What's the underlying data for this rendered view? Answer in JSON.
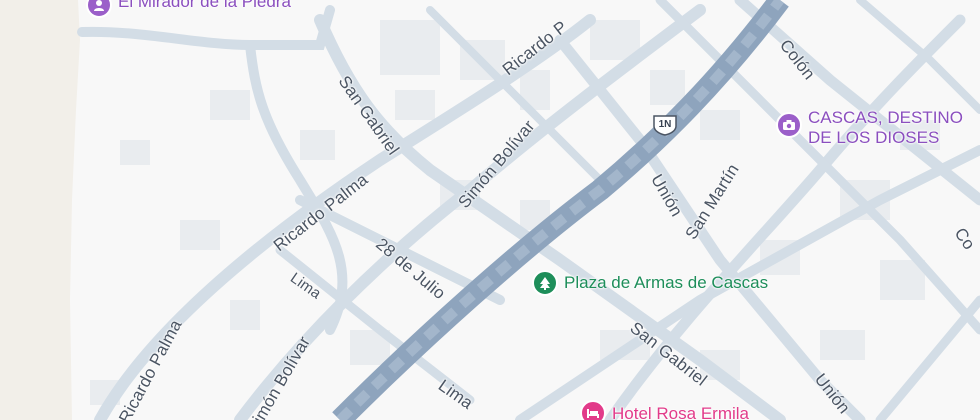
{
  "map": {
    "colors": {
      "background": "#f8f8f8",
      "hillside": "#f2efe9",
      "street": "#d3dde6",
      "highway": "#8ea4bd",
      "building": "#e9ecef",
      "poi_purple": "#9b5fc9",
      "poi_green": "#1e8e5a",
      "poi_pink": "#e23b8a"
    },
    "streets": [
      {
        "id": "ricardo-palma-upper",
        "label": "Ricardo P"
      },
      {
        "id": "san-gabriel-north",
        "label": "San Gabriel"
      },
      {
        "id": "colon",
        "label": "Colón"
      },
      {
        "id": "simon-bolivar-center",
        "label": "Simón Bolívar"
      },
      {
        "id": "ricardo-palma-mid",
        "label": "Ricardo Palma"
      },
      {
        "id": "union-center",
        "label": "Unión"
      },
      {
        "id": "san-martin",
        "label": "San Martín"
      },
      {
        "id": "veinte-ocho-de-julio",
        "label": "28 de Julio"
      },
      {
        "id": "lima-upper",
        "label": "Lima"
      },
      {
        "id": "ricardo-palma-lower",
        "label": "Ricardo Palma"
      },
      {
        "id": "san-gabriel-south",
        "label": "San Gabriel"
      },
      {
        "id": "simon-bolivar-lower",
        "label": "Simón Bolívar"
      },
      {
        "id": "lima-lower",
        "label": "Lima"
      },
      {
        "id": "union-south",
        "label": "Unión"
      },
      {
        "id": "co-edge",
        "label": "Co"
      }
    ],
    "highway_shield": {
      "label": "1N"
    },
    "pois": [
      {
        "id": "mirador",
        "lines": [
          "El Mirador de la Piedra"
        ],
        "icon": "person-pin-icon",
        "color": "#9b5fc9"
      },
      {
        "id": "cascas-destino",
        "lines": [
          "CASCAS, DESTINO",
          "DE LOS DIOSES"
        ],
        "icon": "camera-icon",
        "color": "#9b5fc9"
      },
      {
        "id": "plaza",
        "lines": [
          "Plaza de Armas de Cascas"
        ],
        "icon": "tree-icon",
        "color": "#1e8e5a"
      },
      {
        "id": "hotel",
        "lines": [
          "Hotel Rosa Ermila"
        ],
        "icon": "bed-icon",
        "color": "#e23b8a"
      }
    ]
  }
}
